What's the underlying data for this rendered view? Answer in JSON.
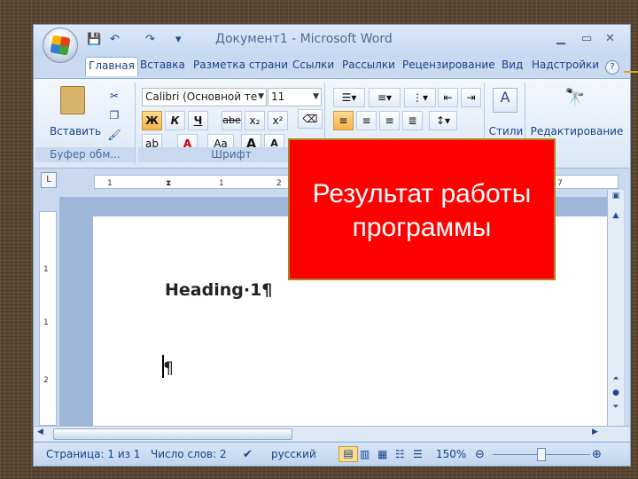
{
  "window": {
    "title": "Документ1 - Microsoft Word"
  },
  "qat": {
    "save": "💾",
    "undo": "↶",
    "redo": "↷",
    "customize": "▾"
  },
  "tabs": [
    {
      "label": "Главная",
      "active": true
    },
    {
      "label": "Вставка"
    },
    {
      "label": "Разметка страни"
    },
    {
      "label": "Ссылки"
    },
    {
      "label": "Рассылки"
    },
    {
      "label": "Рецензирование"
    },
    {
      "label": "Вид"
    },
    {
      "label": "Надстройки"
    }
  ],
  "ribbon": {
    "clipboard": {
      "paste_label": "Вставить",
      "group_label": "Буфер обм..."
    },
    "font": {
      "font_name": "Calibri (Основной те",
      "font_size": "11",
      "group_label": "Шрифт",
      "bold": "Ж",
      "italic": "К",
      "underline": "Ч",
      "strike": "abe",
      "subscript": "x₂",
      "superscript": "x²",
      "grow": "A",
      "shrink": "A",
      "case": "Aa"
    },
    "styles": {
      "label": "Стили"
    },
    "editing": {
      "label": "Редактирование"
    }
  },
  "ruler": {
    "ticks": [
      "1",
      "1",
      "1",
      "2",
      "7"
    ],
    "vticks": [
      "1",
      "1",
      "2"
    ]
  },
  "document": {
    "heading": "Heading·1¶",
    "paragraph": "¶"
  },
  "statusbar": {
    "page": "Страница: 1 из 1",
    "words": "Число слов: 2",
    "language": "русский",
    "zoom": "150%"
  },
  "callout": {
    "line1": "Результат работы",
    "line2": "программы"
  },
  "colors": {
    "callout_bg": "#ff0000",
    "ribbon_accent": "#15428b"
  }
}
